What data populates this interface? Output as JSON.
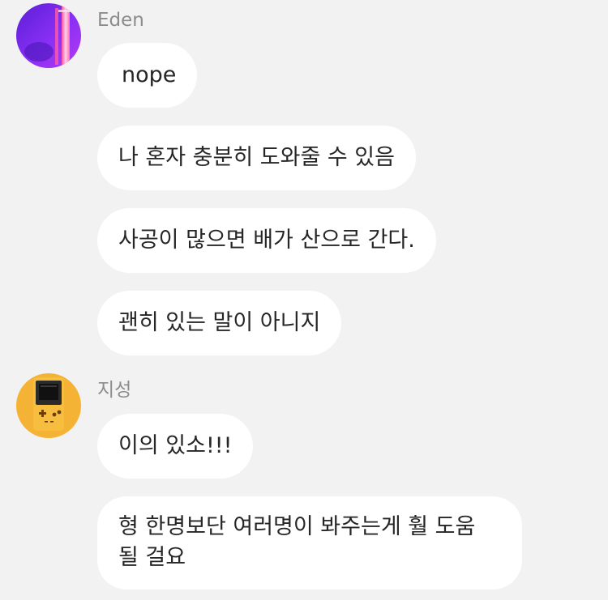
{
  "messages": [
    {
      "sender": "Eden",
      "texts": [
        "nope",
        "나 혼자 충분히 도와줄 수 있음",
        "사공이 많으면 배가 산으로 간다.",
        "괜히 있는 말이 아니지"
      ]
    },
    {
      "sender": "지성",
      "texts": [
        "이의 있소!!!",
        "형 한명보단 여러명이 봐주는게 훨 도움 될 걸요"
      ]
    }
  ],
  "colors": {
    "background": "#f2f2f2",
    "bubble": "#ffffff",
    "text": "#262626",
    "sender_name": "#8c8c8c",
    "avatar_eden": "#7b2ff7",
    "avatar_jiseong": "#f5b335"
  },
  "icons": {
    "avatar_eden": "purple-neon-photo-icon",
    "avatar_jiseong": "gameboy-icon"
  }
}
